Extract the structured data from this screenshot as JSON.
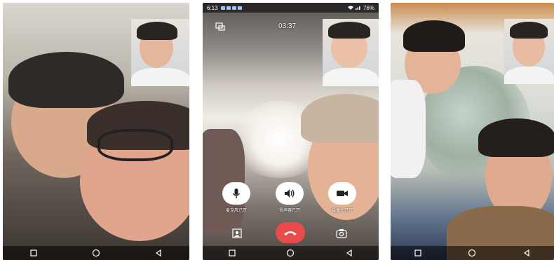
{
  "phone2": {
    "status": {
      "time": "6:13",
      "battery": "76%"
    },
    "call": {
      "timer": "03:37"
    },
    "controls": {
      "mic_label": "麦克风已开",
      "speaker_label": "扬声器已开",
      "camera_label": "摄像头已开"
    }
  },
  "icons": [
    "switch-camera-icon",
    "microphone-icon",
    "speaker-icon",
    "video-camera-icon",
    "hangup-icon",
    "blur-icon",
    "flip-camera-icon",
    "back-icon",
    "home-icon",
    "recent-apps-icon"
  ],
  "colors": {
    "hangup": "#e94b4b",
    "control_bg": "#ffffff",
    "navbar": "rgba(0,0,0,0.55)"
  }
}
